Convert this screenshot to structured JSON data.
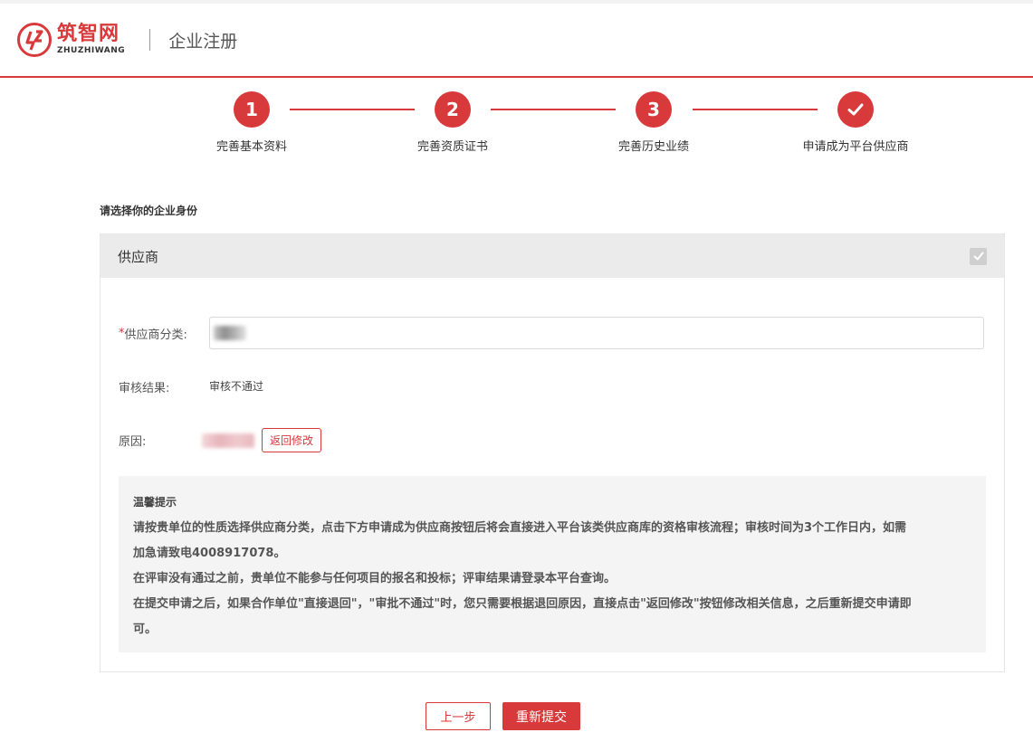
{
  "brand": {
    "name_cn": "筑智网",
    "name_en": "ZHUZHIWANG",
    "color": "#d8393a"
  },
  "header": {
    "title": "企业注册"
  },
  "steps": [
    {
      "number": "1",
      "label": "完善基本资料"
    },
    {
      "number": "2",
      "label": "完善资质证书"
    },
    {
      "number": "3",
      "label": "完善历史业绩"
    },
    {
      "number": "",
      "icon": "check-icon",
      "label": "申请成为平台供应商"
    }
  ],
  "section": {
    "title": "请选择你的企业身份"
  },
  "card": {
    "title": "供应商",
    "checked": true,
    "supplier_category": {
      "required_mark": "*",
      "label": "供应商分类:"
    },
    "review_result": {
      "label": "审核结果:",
      "value": "审核不通过"
    },
    "reason": {
      "label": "原因:",
      "edit_button": "返回修改"
    },
    "tips": {
      "title": "温馨提示",
      "lines": [
        "请按贵单位的性质选择供应商分类，点击下方申请成为供应商按钮后将会直接进入平台该类供应商库的资格审核流程；审核时间为3个工作日内，如需",
        "加急请致电4008917078。",
        "在评审没有通过之前，贵单位不能参与任何项目的报名和投标；评审结果请登录本平台查询。",
        "在提交申请之后，如果合作单位\"直接退回\"，\"审批不通过\"时，您只需要根据退回原因，直接点击\"返回修改\"按钮修改相关信息，之后重新提交申请即",
        "可。"
      ]
    }
  },
  "actions": {
    "prev_label": "上一步",
    "submit_label": "重新提交"
  }
}
